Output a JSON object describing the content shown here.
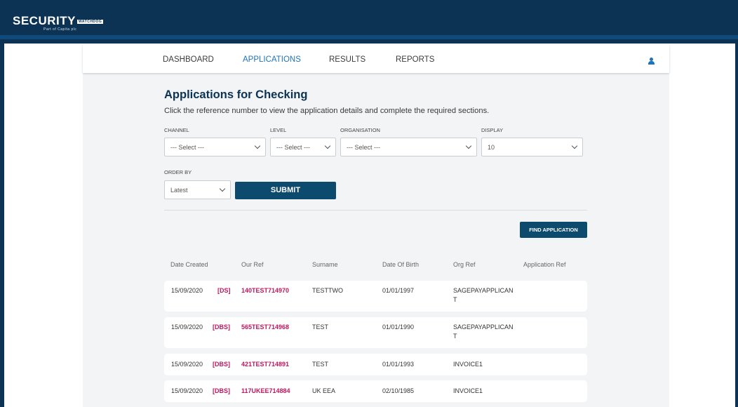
{
  "brand": {
    "logo_text": "SECURITY",
    "badge": "WATCHDOG",
    "tagline": "Part of Capita plc"
  },
  "nav": {
    "items": [
      {
        "label": "DASHBOARD"
      },
      {
        "label": "APPLICATIONS"
      },
      {
        "label": "RESULTS"
      },
      {
        "label": "REPORTS"
      }
    ],
    "active": "APPLICATIONS"
  },
  "page": {
    "title": "Applications for Checking",
    "subtitle": "Click the reference number to view the application details and complete the required sections."
  },
  "filters": {
    "channel": {
      "label": "CHANNEL",
      "value": "--- Select ---"
    },
    "level": {
      "label": "LEVEL",
      "value": "--- Select ---"
    },
    "organisation": {
      "label": "ORGANISATION",
      "value": "--- Select ---"
    },
    "display": {
      "label": "DISPLAY",
      "value": "10"
    },
    "order_by": {
      "label": "ORDER BY",
      "value": "Latest"
    },
    "submit_label": "SUBMIT"
  },
  "find_button": "FIND APPLICATION",
  "table": {
    "headers": [
      "Date Created",
      "Our Ref",
      "Surname",
      "Date Of Birth",
      "Org Ref",
      "Application Ref"
    ],
    "rows": [
      {
        "date": "15/09/2020",
        "tag": "[DS]",
        "ref": "140TEST714970",
        "surname": "TESTTWO",
        "dob": "01/01/1997",
        "org_ref_line1": "SAGEPAYAPPLICAN",
        "org_ref_line2": "T",
        "app_ref": ""
      },
      {
        "date": "15/09/2020",
        "tag": "[DBS]",
        "ref": "565TEST714968",
        "surname": "TEST",
        "dob": "01/01/1990",
        "org_ref_line1": "SAGEPAYAPPLICAN",
        "org_ref_line2": "T",
        "app_ref": ""
      },
      {
        "date": "15/09/2020",
        "tag": "[DBS]",
        "ref": "421TEST714891",
        "surname": "TEST",
        "dob": "01/01/1993",
        "org_ref_line1": "INVOICE1",
        "org_ref_line2": "",
        "app_ref": ""
      },
      {
        "date": "15/09/2020",
        "tag": "[DBS]",
        "ref": "117UKEE714884",
        "surname": "UK EEA",
        "dob": "02/10/1985",
        "org_ref_line1": "INVOICE1",
        "org_ref_line2": "",
        "app_ref": ""
      }
    ]
  },
  "colors": {
    "brand_dark": "#0c3354",
    "accent_blue": "#1f73b7",
    "ref_pink": "#c0175d",
    "button": "#0c4a6e"
  }
}
